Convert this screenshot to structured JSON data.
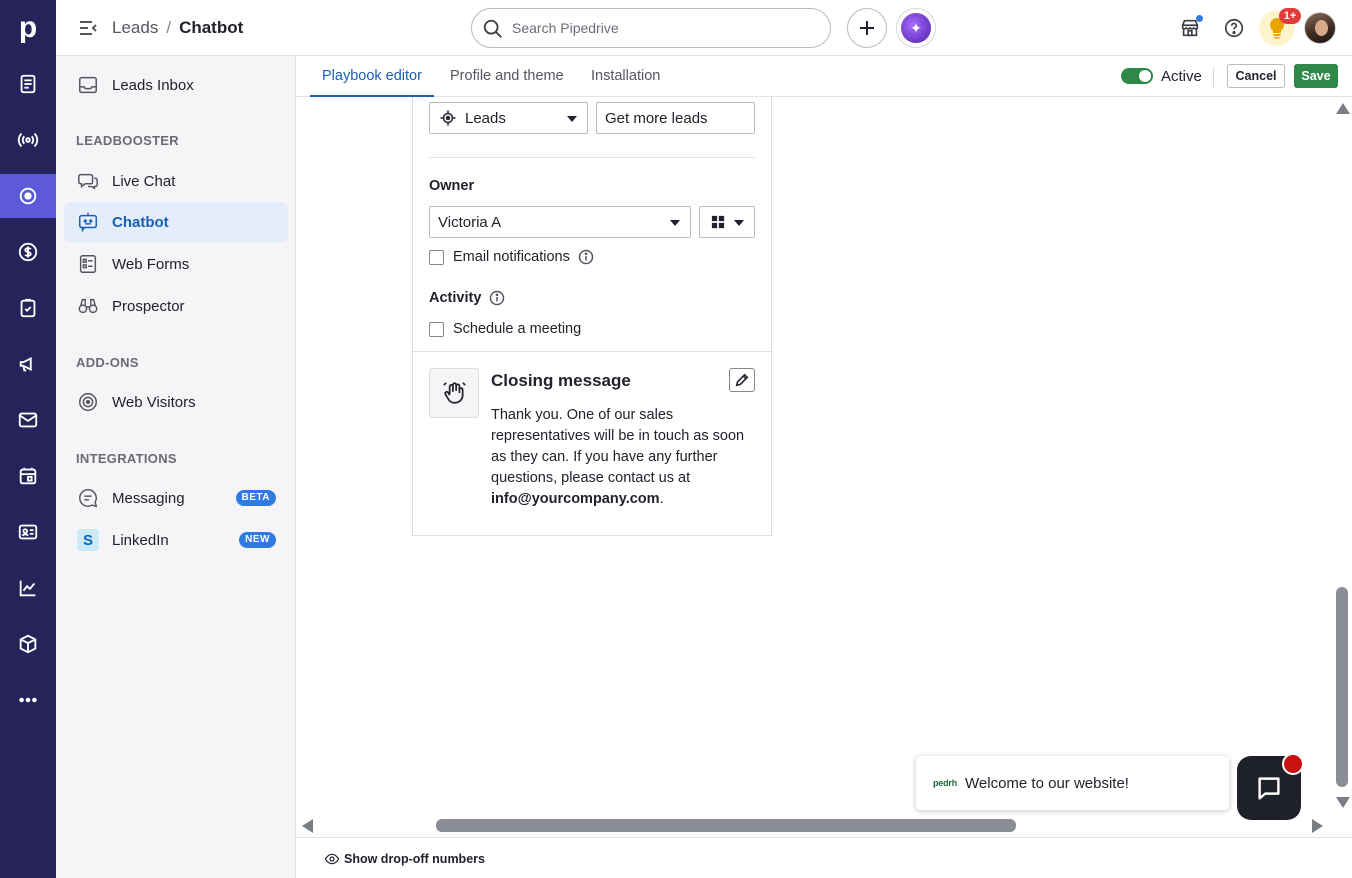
{
  "topbar": {
    "breadcrumb_root": "Leads",
    "breadcrumb_sep": "/",
    "breadcrumb_current": "Chatbot",
    "search_placeholder": "Search Pipedrive",
    "tips_badge": "1+"
  },
  "rail": {
    "logo": "p",
    "icons": [
      "leads-icon",
      "deals-radio-icon",
      "leadbooster-icon",
      "dollar-icon",
      "tasks-icon",
      "campaigns-icon",
      "mail-icon",
      "calendar-icon",
      "contacts-icon",
      "insights-icon",
      "products-icon",
      "more-icon"
    ]
  },
  "sidenav": {
    "leads_inbox": "Leads Inbox",
    "section_leadbooster": "LEADBOOSTER",
    "live_chat": "Live Chat",
    "chatbot": "Chatbot",
    "web_forms": "Web Forms",
    "prospector": "Prospector",
    "section_addons": "ADD-ONS",
    "web_visitors": "Web Visitors",
    "section_integrations": "INTEGRATIONS",
    "messaging": "Messaging",
    "messaging_badge": "BETA",
    "linkedin": "LinkedIn",
    "linkedin_badge": "NEW"
  },
  "tabs": {
    "playbook_editor": "Playbook editor",
    "profile_theme": "Profile and theme",
    "installation": "Installation",
    "active_label": "Active",
    "cancel": "Cancel",
    "save": "Save"
  },
  "card": {
    "pipeline_value": "Leads",
    "target_value": "Get more leads",
    "owner_label": "Owner",
    "owner_value": "Victoria A",
    "email_notifications": "Email notifications",
    "activity_label": "Activity",
    "schedule_meeting": "Schedule a meeting",
    "closing_title": "Closing message",
    "closing_text": "Thank you. One of our sales representatives will be in touch as soon as they can. If you have any further questions, please contact us at",
    "closing_email": "info@yourcompany.com",
    "closing_end": "."
  },
  "bottom": {
    "dropoff": "Show drop-off numbers"
  },
  "widget": {
    "brand": "pedrh",
    "welcome": "Welcome to our website!"
  },
  "colors": {
    "rail_bg": "#26235a",
    "accent_blue": "#1a5fb4",
    "save_green": "#2f8a4a",
    "badge_blue": "#317ae2"
  }
}
